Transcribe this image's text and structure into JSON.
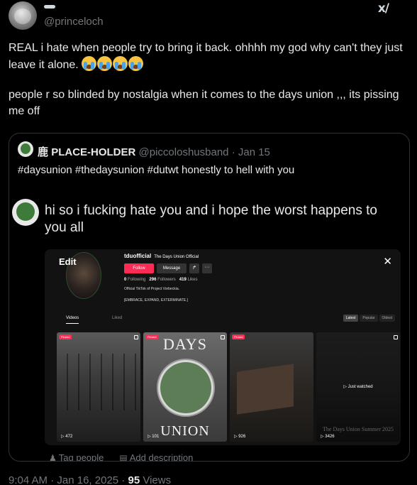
{
  "post": {
    "handle": "@princeloch",
    "paragraph1": "REAL i hate when people try to bring it back. ohhhh my god why can't they just leave it alone.",
    "emoji_name": "loudly-crying-face-emoji",
    "emoji_count": 4,
    "paragraph2": "people r so blinded by nostalgia when it comes to the days union ,,, its pissing me off",
    "time": "9:04 AM",
    "date": "Jan 16, 2025",
    "views_count": "95",
    "views_label": "Views"
  },
  "quote": {
    "name_prefix": "鹿",
    "name": "PLACE-HOLDER",
    "handle": "@piccoloshusband",
    "date": "Jan 15",
    "separator": "·",
    "text": "#daysunion #thedaysunion #dutwt honestly to hell with you",
    "inner_text": "hi so i fucking hate you and i hope the worst happens to you all",
    "tag_people": "Tag people",
    "add_description": "Add description"
  },
  "tiktok": {
    "edit_label": "Edit",
    "username": "tduofficial",
    "display_name": "The Days Union Official",
    "follow": "Follow",
    "message": "Message",
    "stats": {
      "following": "0",
      "following_label": "Following",
      "followers": "296",
      "followers_label": "Followers",
      "likes": "419",
      "likes_label": "Likes"
    },
    "bio1": "Official TikTok of Project Vorbeckia.",
    "bio2": "[EMBRACE, EXPAND, EXTERMINATE.]",
    "tab_videos": "Videos",
    "tab_liked": "Liked",
    "sort": [
      "Latest",
      "Popular",
      "Oldest"
    ],
    "pinned_label": "Pinned",
    "videos": [
      {
        "views": "472"
      },
      {
        "views": "101",
        "top_text": "DAYS",
        "bottom_text": "UNION"
      },
      {
        "views": "926"
      },
      {
        "views": "3426",
        "overlay": "Just watched",
        "caption": "The Days Union Summer 2025"
      }
    ]
  },
  "colors": {
    "background": "#000000",
    "text": "#e7e9ea",
    "muted": "#71767b",
    "border": "#2f3336",
    "tiktok_red": "#fe2c55"
  }
}
